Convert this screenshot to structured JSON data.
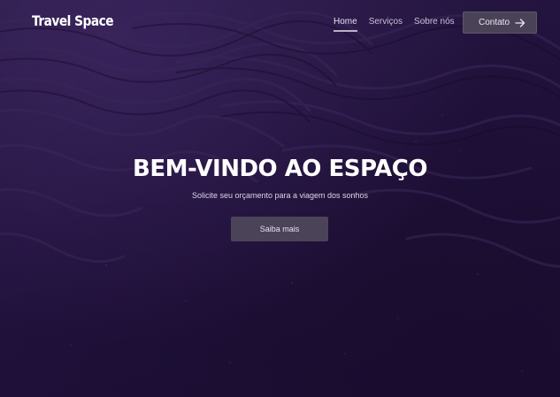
{
  "brand": {
    "logo_text": "Travel Space"
  },
  "nav": {
    "items": [
      {
        "label": "Home",
        "active": true
      },
      {
        "label": "Serviços",
        "active": false
      },
      {
        "label": "Sobre nós",
        "active": false
      }
    ],
    "contact_label": "Contato"
  },
  "hero": {
    "headline": "BEM-VINDO AO ESPAÇO",
    "subtitle": "Solicite seu orçamento para a viagem dos sonhos",
    "cta_label": "Saiba mais"
  },
  "icons": {
    "contact_arrow": "arrow-right-icon"
  },
  "colors": {
    "background": "#21123d",
    "button": "#4a4358",
    "text": "#ffffff"
  }
}
